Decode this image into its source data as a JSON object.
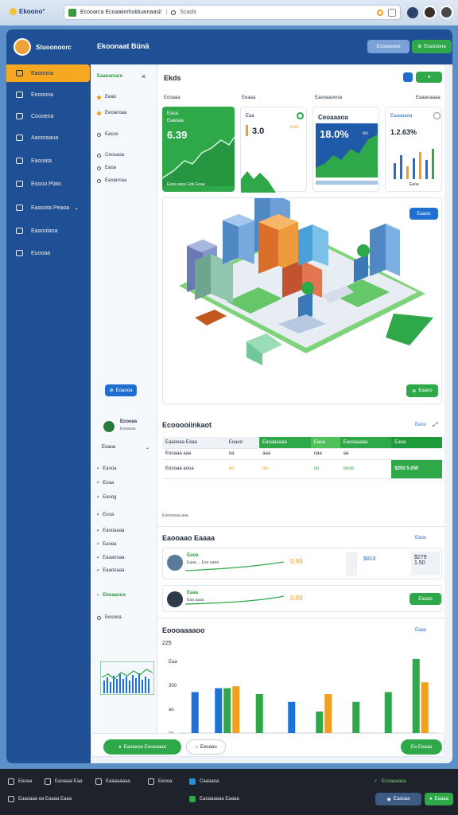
{
  "browser": {
    "brand": "Ekoono°",
    "url": "Ecooarca Ecoaaiinrhoiduamaasi/",
    "url_extra": "Scaols",
    "brand_color": "#f2c230"
  },
  "sidebar": {
    "app_name": "Stuoonoorc",
    "items": [
      {
        "label": "Eaoonna",
        "icon": "folder-icon",
        "active": true
      },
      {
        "label": "Eeooona",
        "icon": "home-icon"
      },
      {
        "label": "Coooena",
        "icon": "document-icon"
      },
      {
        "label": "Aaooraaua",
        "icon": "layers-icon"
      },
      {
        "label": "Eaooata",
        "icon": "chart-icon"
      },
      {
        "label": "Eoooo Plato",
        "icon": "settings-icon"
      },
      {
        "label": "Eaaoota Peaoa",
        "icon": "location-icon"
      },
      {
        "label": "Eaaoolana",
        "icon": "map-icon"
      },
      {
        "label": "Euooaa",
        "icon": "user-icon"
      }
    ]
  },
  "header": {
    "title": "Ekoonaat Bünä",
    "btn_secondary": "Ecoseoeoo",
    "btn_primary": "Eoaooona"
  },
  "left_panel": {
    "header": "Eaaoaniaro",
    "close": "×",
    "groups": [
      {
        "label": "Eeao",
        "bullet": "o"
      },
      {
        "label": "Eeoanoaa",
        "bullet": "o"
      },
      {
        "label": "Eacos",
        "bullet": "n"
      },
      {
        "label": "Ceosaoa",
        "bullet": "n"
      },
      {
        "label": "Eaoa",
        "bullet": "n"
      },
      {
        "label": "Eaoannaa",
        "bullet": "n"
      }
    ],
    "left_button": "Eoaooa",
    "profile_name": "Ecooas",
    "profile_sub": "Eooaaas",
    "dropdown": "Eoaoa",
    "nav": [
      "Eaooa",
      "Eoaa",
      "Eaoog",
      "Eooa",
      "Eaooaaaa",
      "Eaoea",
      "Eaaaooaa",
      "Eaaooaaa",
      "Eboaaooa",
      "Eeoooa"
    ]
  },
  "panel": {
    "title": "Ekds",
    "kpi_headers": [
      "Eooaaa",
      "Eeaaa",
      "Eaooaaoooa",
      "Eaaaoaaaa"
    ],
    "kpis": [
      {
        "label": "Eaoa",
        "sub": "Eaaoaa",
        "value": "6.39",
        "foot": "Eaoa aaoa Ede Eeaa",
        "color": "#2fa84a"
      },
      {
        "label": "Eaa",
        "value": "3.0",
        "extra": "ooo"
      },
      {
        "label": "Ceoaaaoa",
        "value": "18.0%",
        "extra": "oo",
        "color": "#1e5aa8"
      },
      {
        "label": "Eaaaaaoa",
        "value": "1.2.63%",
        "foot": "Eaoa"
      }
    ],
    "map_btn_top": "Eaaoo",
    "map_btn_bottom": "Eaaoo"
  },
  "forecast": {
    "title": "Ecooooiinkaot",
    "link": "Eeoo",
    "columns": [
      "Eaaooaa Eoaa",
      "Eoaoo",
      "Eaoaaaaaa",
      "Eaoa",
      "Eaooaaaaa",
      "Eaoa"
    ],
    "rows": [
      [
        "Eooaaa aaa",
        "oa",
        "aaa",
        "oaa",
        "aa",
        ""
      ],
      [
        "Eoooaa aooa",
        "oo",
        "oo",
        "oo",
        "oooo",
        "$250 5.050"
      ]
    ],
    "footnote": "Eoooaoaa aaa"
  },
  "trend": {
    "title": "Eaooaao Eaaaa",
    "link": "Eaoo",
    "rows": [
      {
        "name": "Eaoa",
        "sub": "Eaaa ... Eao aaaa",
        "value": "0.99",
        "mid": "$819",
        "right": "$279 1.50"
      },
      {
        "name": "Eaaa",
        "sub": "Eaa aaaa",
        "value": "0.99",
        "btn": "Eaoao"
      }
    ]
  },
  "bar_chart": {
    "title": "Eoooaaaaoo",
    "link": "Eaaa",
    "y_top": "225",
    "y_ticks": [
      "Eaa",
      "300",
      "ao",
      "ao"
    ],
    "x_labels": [
      "Eaoo",
      "Eaaa",
      "Eaoa",
      "Eaoa",
      "Eaoa",
      "Eaoo",
      "Eaa",
      "Eaoo Eaa"
    ]
  },
  "chart_data": {
    "type": "bar",
    "categories": [
      "Eaoo",
      "Eaaa",
      "Eaoa",
      "Eaoa",
      "Eaoa",
      "Eaoo",
      "Eaa",
      "Eaoo Eaa"
    ],
    "series": [
      {
        "values": [
          210,
          0,
          0,
          160,
          0,
          0,
          0,
          0
        ],
        "color": "#1d72d8"
      },
      {
        "values": [
          0,
          230,
          0,
          0,
          0,
          0,
          0,
          0
        ],
        "color": "#1d72d8"
      },
      {
        "values": [
          0,
          230,
          200,
          0,
          110,
          160,
          210,
          380
        ],
        "color": "#2fa84a"
      },
      {
        "values": [
          0,
          240,
          0,
          0,
          200,
          0,
          0,
          260
        ],
        "color": "#f0a020"
      }
    ]
  },
  "footer": {
    "left_pill": "Eaoaaoa Eooaaaaa",
    "mid_pill": "Eeoaao",
    "right_pill": "Ea Eeaaa"
  },
  "taskbar": {
    "items_row1": [
      "Eeoaa",
      "Eaoaaai Eaa",
      "Eaaaaaaaa",
      "Eeooa",
      "Caaaaoa"
    ],
    "items_row2": [
      "Eaaoaaa ea Eaaaa Eaaa",
      "Eaoaaaaaa Eaaaa"
    ],
    "right1": "Eooaaaaaa",
    "right2a": "Eaaoaa",
    "right2b": "Eaaaa"
  }
}
